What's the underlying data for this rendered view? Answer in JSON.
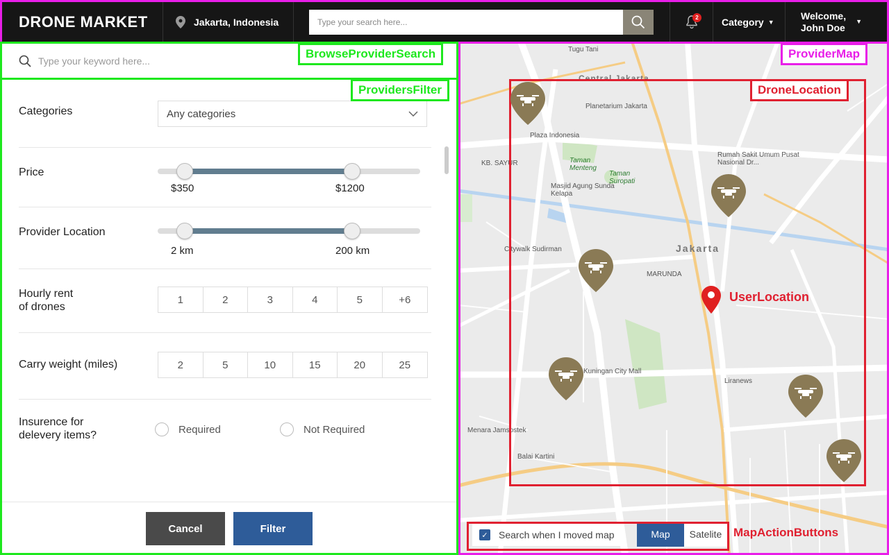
{
  "header": {
    "logo": "DRONE MARKET",
    "location": "Jakarta, Indonesia",
    "search_placeholder": "Type your search here...",
    "notification_count": "2",
    "category_label": "Category",
    "welcome_line1": "Welcome,",
    "welcome_line2": "John Doe"
  },
  "left": {
    "keyword_placeholder": "Type your keyword here...",
    "annotation_search": "BrowseProviderSearch",
    "annotation_filter": "ProvidersFilter",
    "categories_label": "Categories",
    "categories_value": "Any categories",
    "price_label": "Price",
    "price_min": "$350",
    "price_max": "$1200",
    "location_label": "Provider Location",
    "location_min": "2 km",
    "location_max": "200 km",
    "hourly_label_1": "Hourly rent",
    "hourly_label_2": "of drones",
    "hourly_options": [
      "1",
      "2",
      "3",
      "4",
      "5",
      "+6"
    ],
    "weight_label": "Carry weight (miles)",
    "weight_options": [
      "2",
      "5",
      "10",
      "15",
      "20",
      "25"
    ],
    "insurance_label_1": "Insurence for",
    "insurance_label_2": "delevery items?",
    "insurance_options": [
      "Required",
      "Not Required"
    ],
    "cancel_label": "Cancel",
    "filter_label": "Filter"
  },
  "map": {
    "annotation_map": "ProviderMap",
    "annotation_drone": "DroneLocation",
    "annotation_user": "UserLocation",
    "annotation_actions": "MapActionButtons",
    "search_when_moved": "Search when I moved map",
    "map_btn": "Map",
    "satellite_btn": "Satelite",
    "labels": {
      "tugu_tani": "Tugu Tani",
      "central_jakarta": "Central Jakarta",
      "planetarium": "Planetarium Jakarta",
      "plaza_indonesia": "Plaza Indonesia",
      "taman_menteng": "Taman Menteng",
      "taman_suropati": "Taman Suropati",
      "rumah_sakit": "Rumah Sakit Umum Pusat Nasional Dr...",
      "masjid": "Masjid Agung Sunda Kelapa",
      "jakarta": "Jakarta",
      "citywalk": "Citywalk Sudirman",
      "marunda": "MARUNDA",
      "kuningan": "Kuningan City Mall",
      "liranews": "Liranews",
      "menara": "Menara Jamsostek",
      "balai": "Balai Kartini",
      "kb_sayur": "KB. SAYUR"
    }
  },
  "colors": {
    "header_bg": "#161616",
    "accent_blue": "#2e5c99",
    "slider_fill": "#617d8f",
    "drone_pin": "#8a7a55",
    "user_pin": "#e02020"
  }
}
